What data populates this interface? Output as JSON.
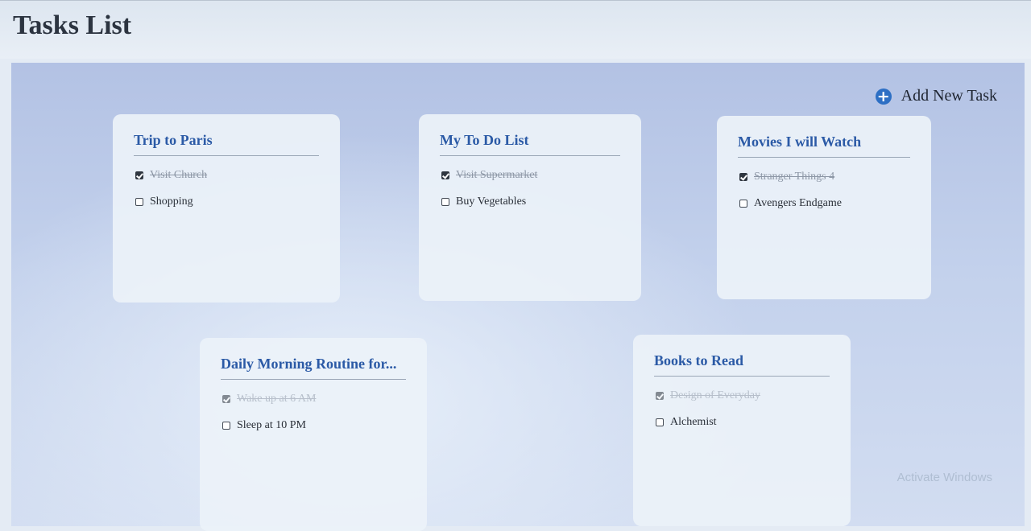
{
  "page": {
    "title": "Tasks List"
  },
  "toolbar": {
    "add_label": "Add New Task",
    "add_icon": "plus-circle-icon",
    "accent": "#2d6fc4"
  },
  "lists": [
    {
      "title": "Trip to Paris",
      "tasks": [
        {
          "label": "Visit Church",
          "done": true
        },
        {
          "label": "Shopping",
          "done": false
        }
      ]
    },
    {
      "title": "My To Do List",
      "tasks": [
        {
          "label": "Visit Supermarket",
          "done": true
        },
        {
          "label": "Buy Vegetables",
          "done": false
        }
      ]
    },
    {
      "title": "Movies I will Watch",
      "tasks": [
        {
          "label": "Stranger Things 4",
          "done": true
        },
        {
          "label": "Avengers Endgame",
          "done": false
        }
      ]
    },
    {
      "title": "Daily Morning Routine for...",
      "tasks": [
        {
          "label": "Wake up at 6 AM",
          "done": true
        },
        {
          "label": "Sleep at 10 PM",
          "done": false
        }
      ]
    },
    {
      "title": "Books to Read",
      "tasks": [
        {
          "label": "Design of Everyday",
          "done": true
        },
        {
          "label": "Alchemist",
          "done": false
        }
      ]
    }
  ],
  "watermark": {
    "text": "Activate Windows"
  }
}
